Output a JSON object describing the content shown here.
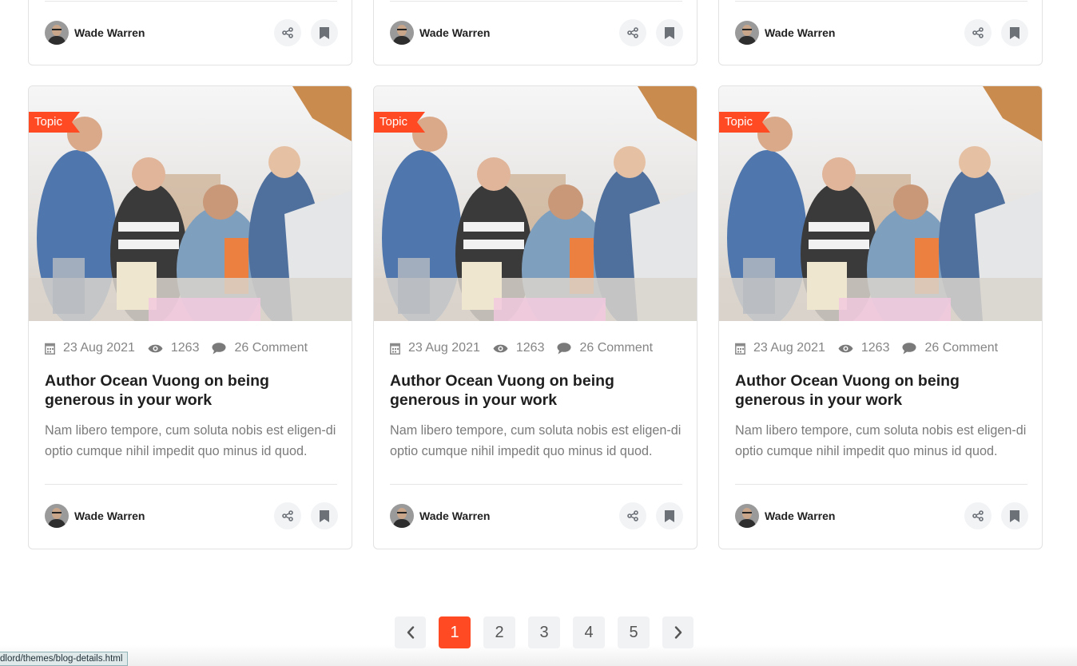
{
  "top_cards": [
    {
      "author": "Wade Warren"
    },
    {
      "author": "Wade Warren"
    },
    {
      "author": "Wade Warren"
    }
  ],
  "posts": [
    {
      "topic": "Topic",
      "date": "23 Aug 2021",
      "views": "1263",
      "comments": "26 Comment",
      "title": "Author Ocean Vuong on being generous in your work",
      "excerpt": "Nam libero tempore, cum soluta nobis est eligen-di optio cumque nihil impedit quo minus id quod.",
      "author": "Wade Warren"
    },
    {
      "topic": "Topic",
      "date": "23 Aug 2021",
      "views": "1263",
      "comments": "26 Comment",
      "title": "Author Ocean Vuong on being generous in your work",
      "excerpt": "Nam libero tempore, cum soluta nobis est eligen-di optio cumque nihil impedit quo minus id quod.",
      "author": "Wade Warren"
    },
    {
      "topic": "Topic",
      "date": "23 Aug 2021",
      "views": "1263",
      "comments": "26 Comment",
      "title": "Author Ocean Vuong on being generous in your work",
      "excerpt": "Nam libero tempore, cum soluta nobis est eligen-di optio cumque nihil impedit quo minus id quod.",
      "author": "Wade Warren"
    }
  ],
  "pagination": {
    "pages": [
      "1",
      "2",
      "3",
      "4",
      "5"
    ],
    "active": "1"
  },
  "status_bar": {
    "url": "dlord/themes/blog-details.html"
  },
  "colors": {
    "accent": "#ff4a23",
    "button_bg": "#f1f3f5",
    "muted_text": "#858585"
  },
  "icons": {
    "share": "share-icon",
    "bookmark": "bookmark-icon",
    "calendar": "calendar-icon",
    "views": "eye-icon",
    "comments": "comment-icon",
    "prev": "chevron-left-icon",
    "next": "chevron-right-icon"
  }
}
